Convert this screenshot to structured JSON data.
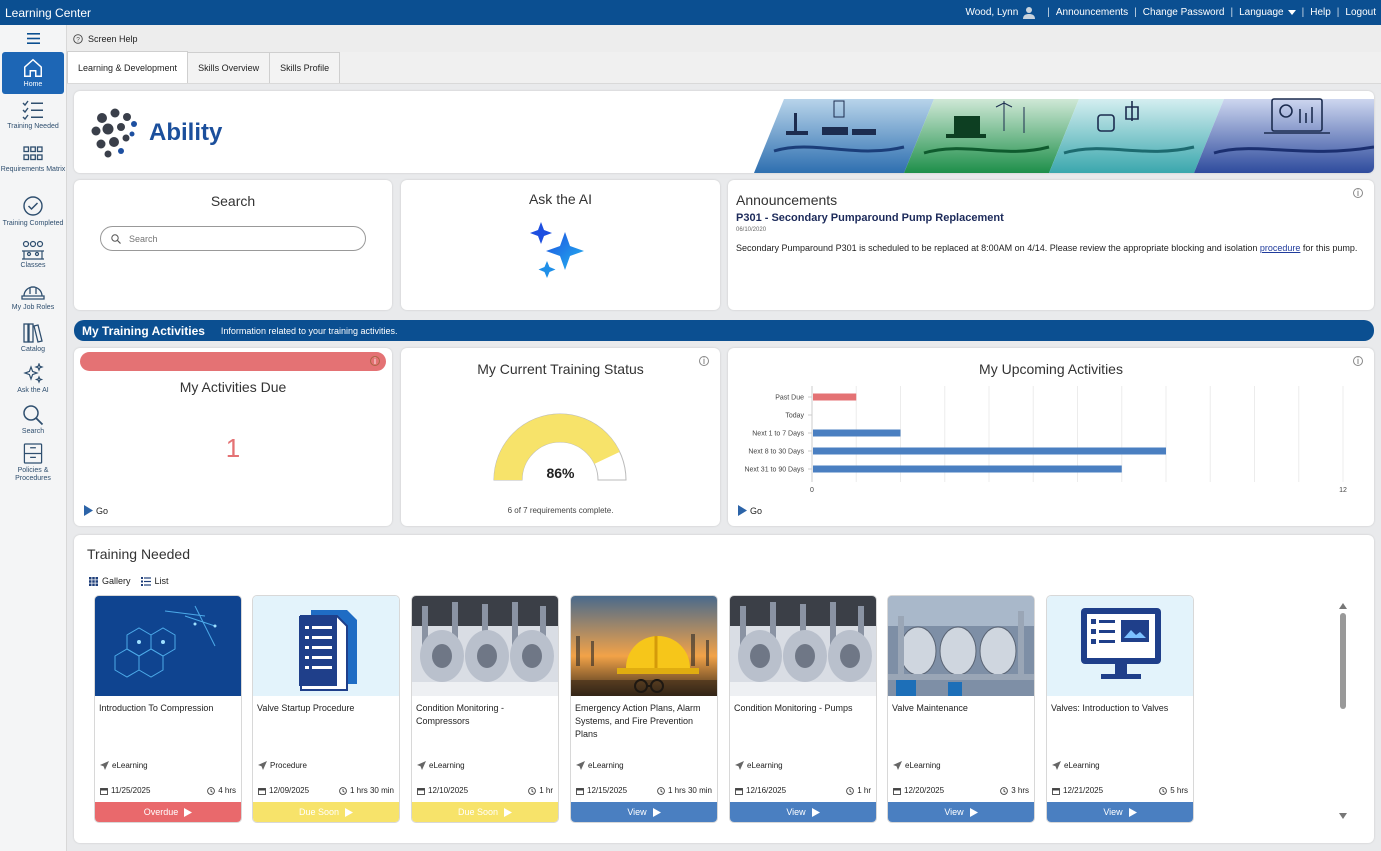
{
  "header": {
    "app_title": "Learning Center",
    "user": "Wood, Lynn",
    "links": [
      "Announcements",
      "Change Password",
      "Language",
      "Help",
      "Logout"
    ]
  },
  "sidebar": {
    "items": [
      {
        "label": "Home",
        "icon": "home-icon",
        "active": true
      },
      {
        "label": "Training Needed",
        "icon": "checklist-icon"
      },
      {
        "label": "Requirements Matrix",
        "icon": "grid-icon"
      },
      {
        "label": "Training Completed",
        "icon": "check-circle-icon"
      },
      {
        "label": "Classes",
        "icon": "classroom-icon"
      },
      {
        "label": "My Job Roles",
        "icon": "hard-hat-icon"
      },
      {
        "label": "Catalog",
        "icon": "books-icon"
      },
      {
        "label": "Ask the AI",
        "icon": "sparkle-icon"
      },
      {
        "label": "Search",
        "icon": "search-icon"
      },
      {
        "label": "Policies & Procedures",
        "icon": "cabinet-icon"
      }
    ]
  },
  "toolbar": {
    "screen_help": "Screen Help"
  },
  "tabs": [
    {
      "label": "Learning & Development",
      "active": true
    },
    {
      "label": "Skills Overview"
    },
    {
      "label": "Skills Profile"
    }
  ],
  "banner": {
    "logo_text": "Ability"
  },
  "search": {
    "title": "Search",
    "placeholder": "Search"
  },
  "ask_ai": {
    "title": "Ask the AI"
  },
  "announcements": {
    "title": "Announcements",
    "headline": "P301 - Secondary Pumparound Pump Replacement",
    "date": "06/10/2020",
    "body_before": "Secondary Pumparound P301 is scheduled to be replaced at 8:00AM on 4/14.  Please review the appropriate blocking and isolation ",
    "body_link": "procedure",
    "body_after": " for this pump."
  },
  "section": {
    "title": "My Training Activities",
    "subtitle": "Information related to your training activities."
  },
  "activities_due": {
    "title": "My Activities Due",
    "count": "1",
    "go": "Go"
  },
  "training_status": {
    "title": "My Current Training Status",
    "percent_label": "86%",
    "percent": 0.86,
    "summary": "6 of 7 requirements complete."
  },
  "upcoming": {
    "title": "My Upcoming Activities",
    "go": "Go"
  },
  "chart_data": {
    "type": "bar",
    "orientation": "horizontal",
    "title": "My Upcoming Activities",
    "categories": [
      "Past Due",
      "Today",
      "Next 1 to 7 Days",
      "Next 8 to 30 Days",
      "Next 31 to 90 Days"
    ],
    "values": [
      1,
      0,
      2,
      8,
      7
    ],
    "xlim": [
      0,
      12
    ],
    "x_ticks": [
      "0",
      "12"
    ],
    "colors": [
      "#e47274",
      "#4a7fc1",
      "#4a7fc1",
      "#4a7fc1",
      "#4a7fc1"
    ],
    "grid": true
  },
  "training_needed": {
    "title": "Training Needed",
    "views": [
      "Gallery",
      "List"
    ],
    "cards": [
      {
        "title": "Introduction To Compression",
        "type": "eLearning",
        "date": "11/25/2025",
        "duration": "4 hrs",
        "action": "Overdue",
        "status": "overdue",
        "image": "compression-image"
      },
      {
        "title": "Valve Startup Procedure",
        "type": "Procedure",
        "date": "12/09/2025",
        "duration": "1 hrs 30 min",
        "action": "Due Soon",
        "status": "due-soon",
        "image": "document-image"
      },
      {
        "title": "Condition Monitoring - Compressors",
        "type": "eLearning",
        "date": "12/10/2025",
        "duration": "1 hr",
        "action": "Due Soon",
        "status": "due-soon",
        "image": "compressor-image"
      },
      {
        "title": "Emergency Action Plans, Alarm Systems, and Fire Prevention Plans",
        "type": "eLearning",
        "date": "12/15/2025",
        "duration": "1 hrs 30 min",
        "action": "View",
        "status": "view",
        "image": "hard-hat-image"
      },
      {
        "title": "Condition Monitoring - Pumps",
        "type": "eLearning",
        "date": "12/16/2025",
        "duration": "1 hr",
        "action": "View",
        "status": "view",
        "image": "compressor-image"
      },
      {
        "title": "Valve Maintenance",
        "type": "eLearning",
        "date": "12/20/2025",
        "duration": "3 hrs",
        "action": "View",
        "status": "view",
        "image": "plant-image"
      },
      {
        "title": "Valves: Introduction to Valves",
        "type": "eLearning",
        "date": "12/21/2025",
        "duration": "5 hrs",
        "action": "View",
        "status": "view",
        "image": "monitor-image"
      }
    ]
  },
  "colors": {
    "brand_blue": "#0b4f91",
    "overdue": "#e9696c",
    "due_soon": "#f7e36a",
    "view": "#4a7fc1",
    "gauge": "#f7e36a"
  }
}
